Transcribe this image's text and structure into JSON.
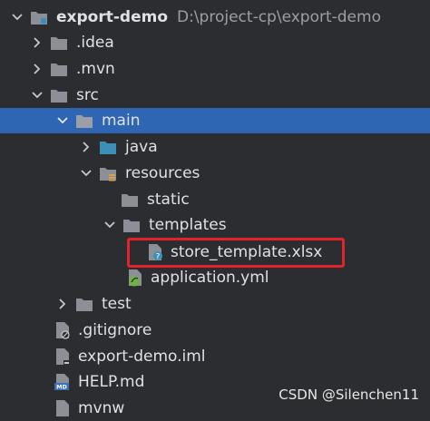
{
  "tree": {
    "root": {
      "label": "export-demo",
      "path": "D:\\project-cp\\export-demo"
    },
    "idea": "idea_placeholder",
    "items": {
      "idea": ".idea",
      "mvn": ".mvn",
      "src": "src",
      "main": "main",
      "java": "java",
      "resources": "resources",
      "static": "static",
      "templates": "templates",
      "store_template": "store_template.xlsx",
      "application": "application.yml",
      "test": "test",
      "gitignore": ".gitignore",
      "iml": "export-demo.iml",
      "help": "HELP.md",
      "mvnw": "mvnw"
    }
  },
  "watermark": "CSDN @Silenchen11",
  "colors": {
    "background": "#2b2d30",
    "selection": "#2f66b3",
    "highlight_border": "#e0242a",
    "folder": "#8c9096",
    "java_folder": "#3d8fb8"
  },
  "icons": {
    "folder": "folder-icon",
    "module": "module-icon",
    "resources": "resources-folder-icon",
    "file_unknown": "unknown-file-icon",
    "spring_config": "spring-config-icon",
    "markdown": "markdown-file-icon"
  }
}
